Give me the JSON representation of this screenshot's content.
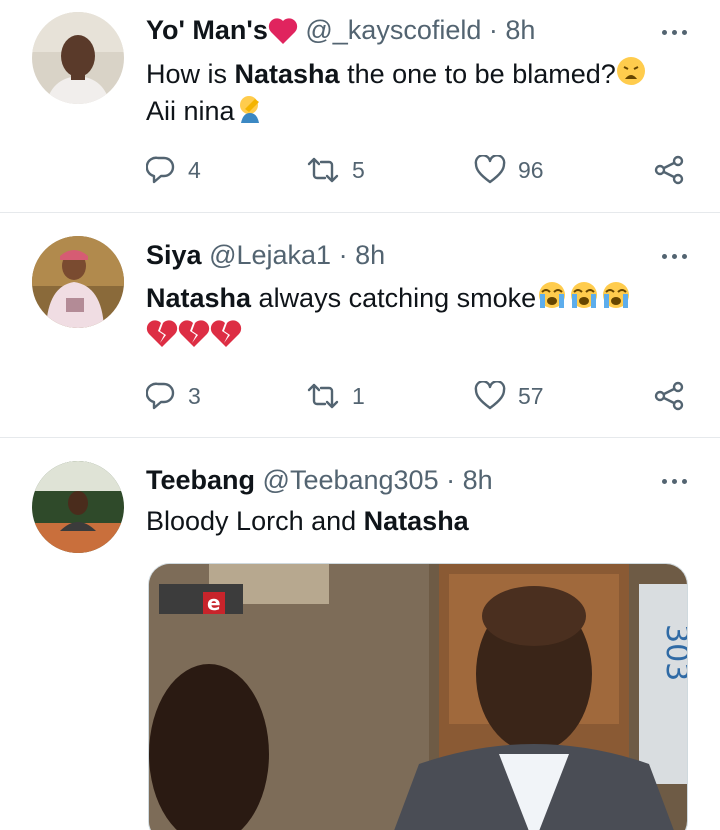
{
  "tweets": [
    {
      "display_name": "Yo' Man's",
      "handle": "@_kayscofield",
      "dot": "·",
      "time": "8h",
      "text_prefix": "How is ",
      "text_bold": "Natasha",
      "text_suffix": " the one to be blamed?",
      "line2": "Aii nina",
      "replies": "4",
      "retweets": "5",
      "likes": "96"
    },
    {
      "display_name": "Siya",
      "handle": "@Lejaka1",
      "dot": "·",
      "time": "8h",
      "text_bold": "Natasha",
      "text_suffix": " always catching smoke",
      "replies": "3",
      "retweets": "1",
      "likes": "57"
    },
    {
      "display_name": "Teebang",
      "handle": "@Teebang305",
      "dot": "·",
      "time": "8h",
      "text_prefix": "Bloody Lorch and ",
      "text_bold": "Natasha",
      "media_channel_logo": "e",
      "media_sign_text": "303"
    }
  ],
  "colors": {
    "text": "#0f1419",
    "secondary": "#536471",
    "divider": "#e6e9ec",
    "heart_red": "#e0245e"
  },
  "icons": [
    "more-icon",
    "reply-icon",
    "retweet-icon",
    "like-icon",
    "share-icon",
    "red-heart-emoji",
    "weary-face-emoji",
    "facepalm-emoji",
    "loudly-crying-emoji",
    "broken-heart-emoji"
  ]
}
